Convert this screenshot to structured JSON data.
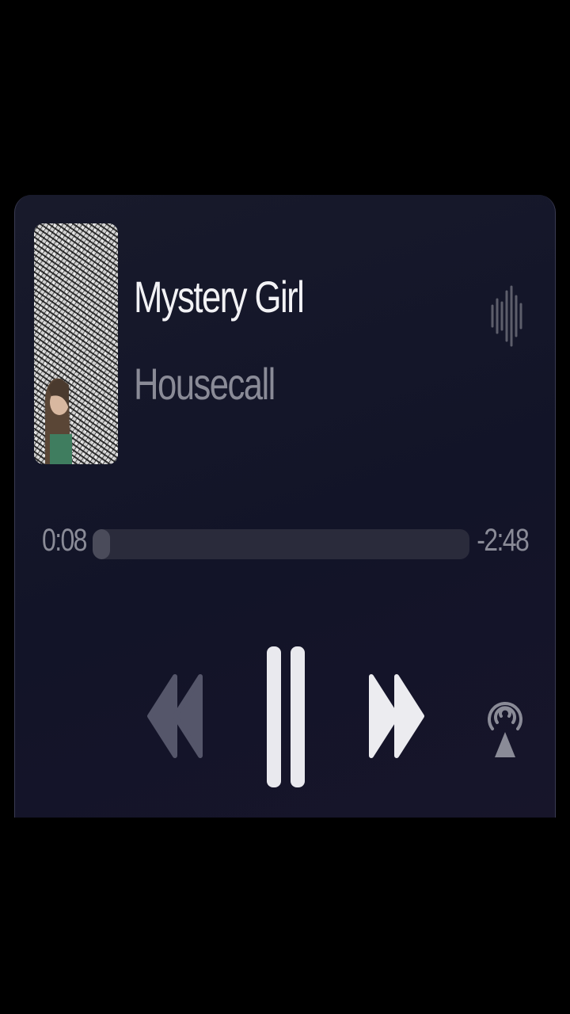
{
  "now_playing": {
    "title": "Mystery Girl",
    "artist": "Housecall"
  },
  "progress": {
    "elapsed": "0:08",
    "remaining": "-2:48",
    "fraction": 0.047
  },
  "controls": {
    "icons": [
      "rewind-icon",
      "pause-icon",
      "fast-forward-icon",
      "airplay-icon",
      "waveform-icon"
    ]
  },
  "colors": {
    "background": "#131528",
    "title": "#f2f2f5",
    "secondary_text": "#8a8b97",
    "track": "#2a2b3b"
  }
}
